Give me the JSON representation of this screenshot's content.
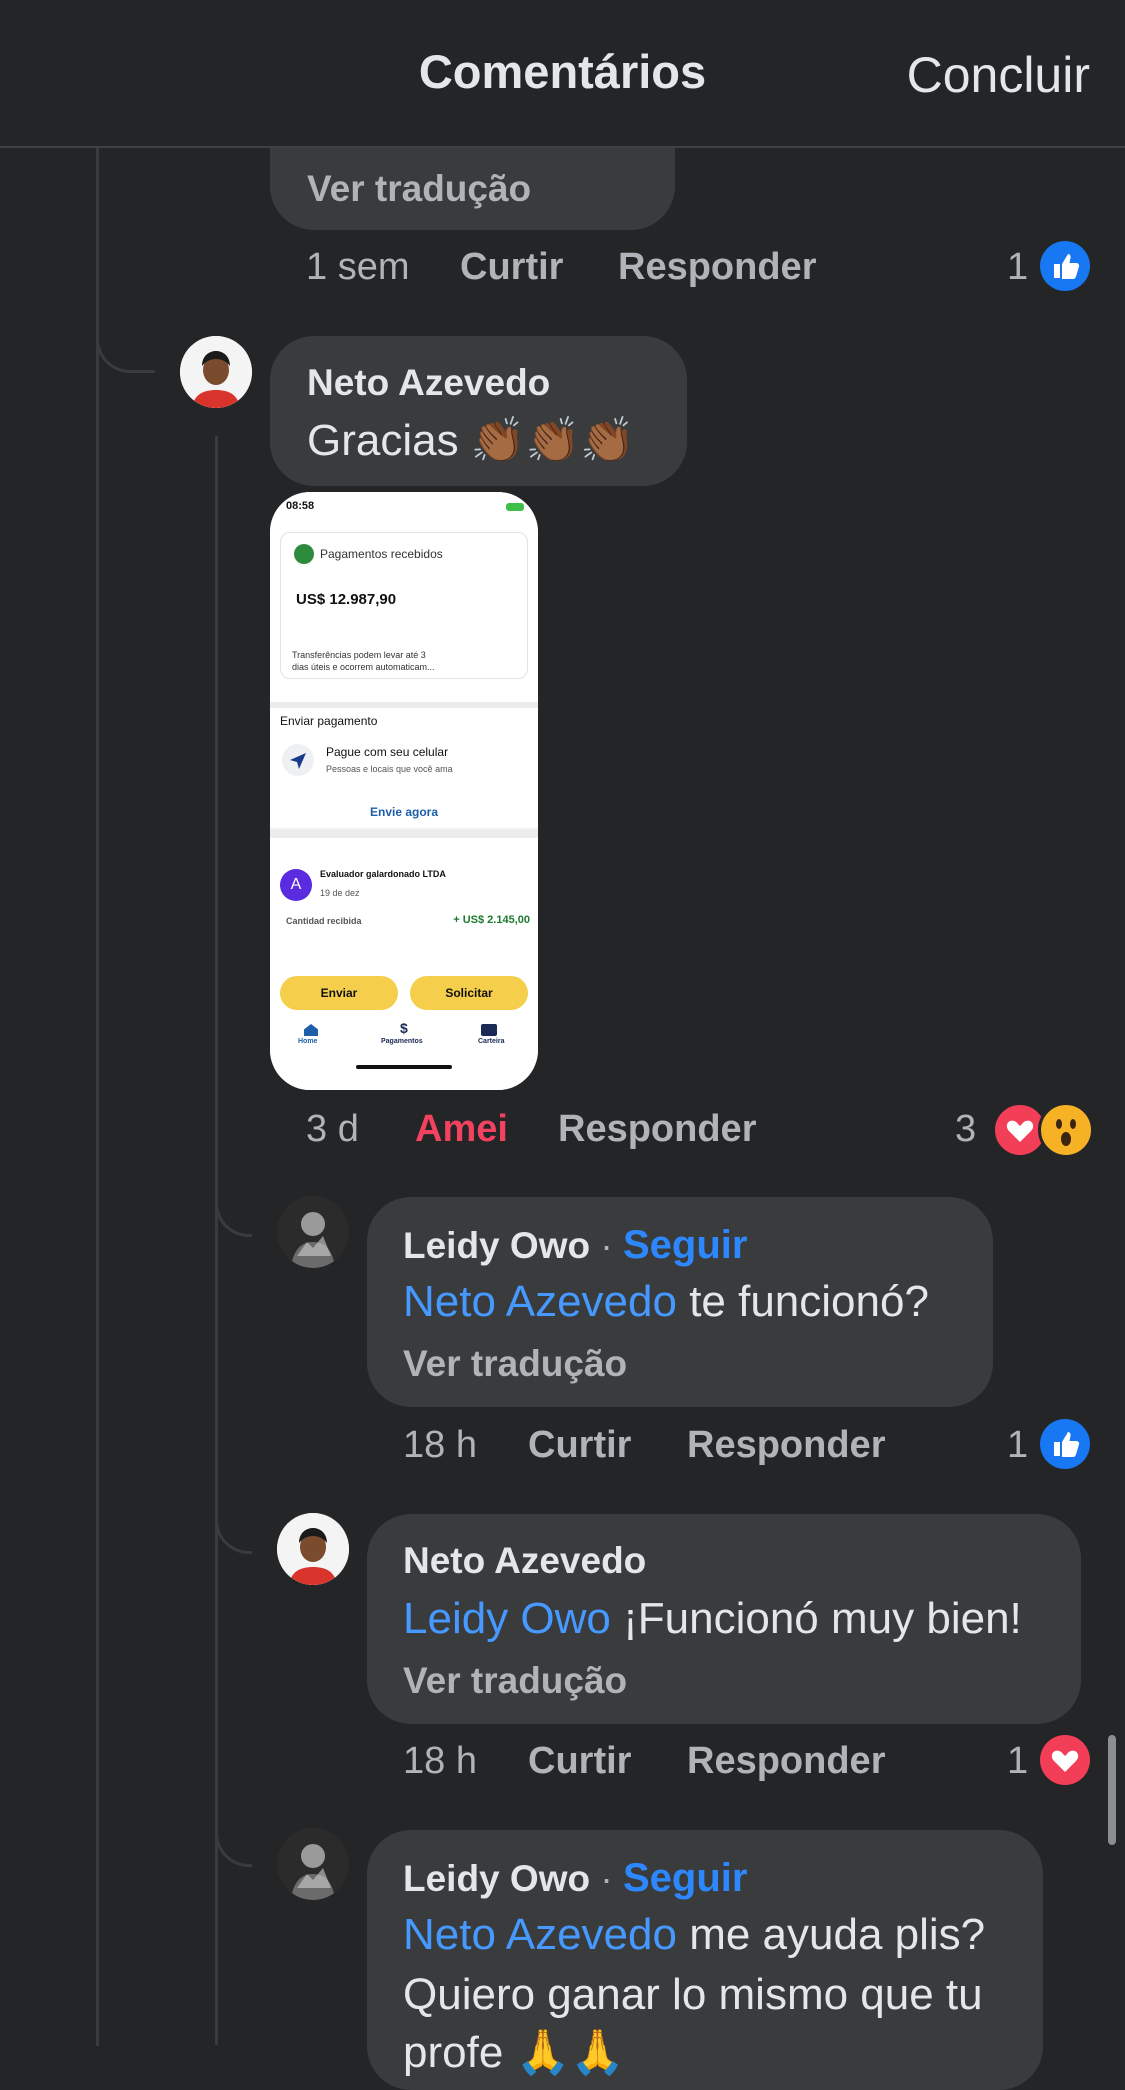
{
  "header": {
    "title": "Comentários",
    "done_label": "Concluir"
  },
  "prev_comment": {
    "translate_label": "Ver tradução",
    "time": "1 sem",
    "like_label": "Curtir",
    "reply_label": "Responder",
    "reaction_count": "1"
  },
  "comment_neto_1": {
    "name": "Neto Azevedo",
    "text": "Gracias 👏🏾👏🏾👏🏾",
    "time": "3 d",
    "like_label": "Amei",
    "reply_label": "Responder",
    "reaction_count": "3",
    "attachment": {
      "status_time": "08:58",
      "card_title": "Pagamentos recebidos",
      "amount": "US$ 12.987,90",
      "card_note_line1": "Transferências podem levar até 3",
      "card_note_line2": "dias úteis e ocorrem automaticam...",
      "send_section": "Enviar pagamento",
      "pay_title": "Pague com seu celular",
      "pay_sub": "Pessoas e locais que você ama",
      "send_now": "Envie agora",
      "tx_avatar": "A",
      "tx_name": "Evaluador galardonado LTDA",
      "tx_date": "19 de dez",
      "tx_label": "Cantidad recibida",
      "tx_amount": "+ US$ 2.145,00",
      "btn_send": "Enviar",
      "btn_request": "Solicitar",
      "nav_home": "Home",
      "nav_payments_icon": "$",
      "nav_payments": "Pagamentos",
      "nav_wallet": "Carteira"
    }
  },
  "reply_leidy_1": {
    "name": "Leidy Owo",
    "separator": "·",
    "follow_label": "Seguir",
    "mention": "Neto Azevedo",
    "text": " te funcionó?",
    "translate_label": "Ver tradução",
    "time": "18 h",
    "like_label": "Curtir",
    "reply_label": "Responder",
    "reaction_count": "1"
  },
  "reply_neto_2": {
    "name": "Neto Azevedo",
    "mention": "Leidy Owo",
    "text": " ¡Funcionó muy bien!",
    "translate_label": "Ver tradução",
    "time": "18 h",
    "like_label": "Curtir",
    "reply_label": "Responder",
    "reaction_count": "1"
  },
  "reply_leidy_2": {
    "name": "Leidy Owo",
    "separator": "·",
    "follow_label": "Seguir",
    "mention": "Neto Azevedo",
    "text_line1": " me ayuda plis?",
    "text_line2": "Quiero ganar lo mismo que tu",
    "text_line3": "profe 🙏🙏"
  },
  "colors": {
    "background": "#242526",
    "bubble": "#3a3b3c",
    "link": "#4599ff",
    "loved": "#f3425f",
    "like": "#1877f2"
  }
}
